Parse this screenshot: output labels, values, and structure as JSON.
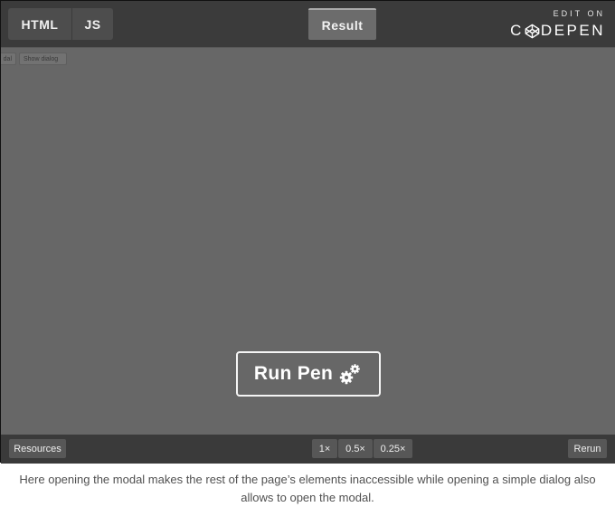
{
  "tabs": {
    "html_label": "HTML",
    "js_label": "JS",
    "result_label": "Result"
  },
  "brand": {
    "edit_on": "EDIT ON",
    "codepen_before": "C",
    "codepen_after": "DEPEN",
    "icon": "codepen-logo-icon"
  },
  "preview": {
    "mini_buttons": {
      "first": "dal",
      "second": "Show dialog"
    },
    "run_pen_label": "Run Pen",
    "run_pen_icon": "gears-icon"
  },
  "bottombar": {
    "resources_label": "Resources",
    "zoom_options": [
      "1×",
      "0.5×",
      "0.25×"
    ],
    "rerun_label": "Rerun"
  },
  "caption": {
    "line1": "Here opening the modal makes the rest of the page’s elements inaccessible while opening a simple dialog also",
    "line2": "allows to open the modal."
  },
  "colors": {
    "topbar": "#3b3b3b",
    "preview": "#676767",
    "bottombar": "#3a3a3a",
    "caption": "#505050"
  }
}
